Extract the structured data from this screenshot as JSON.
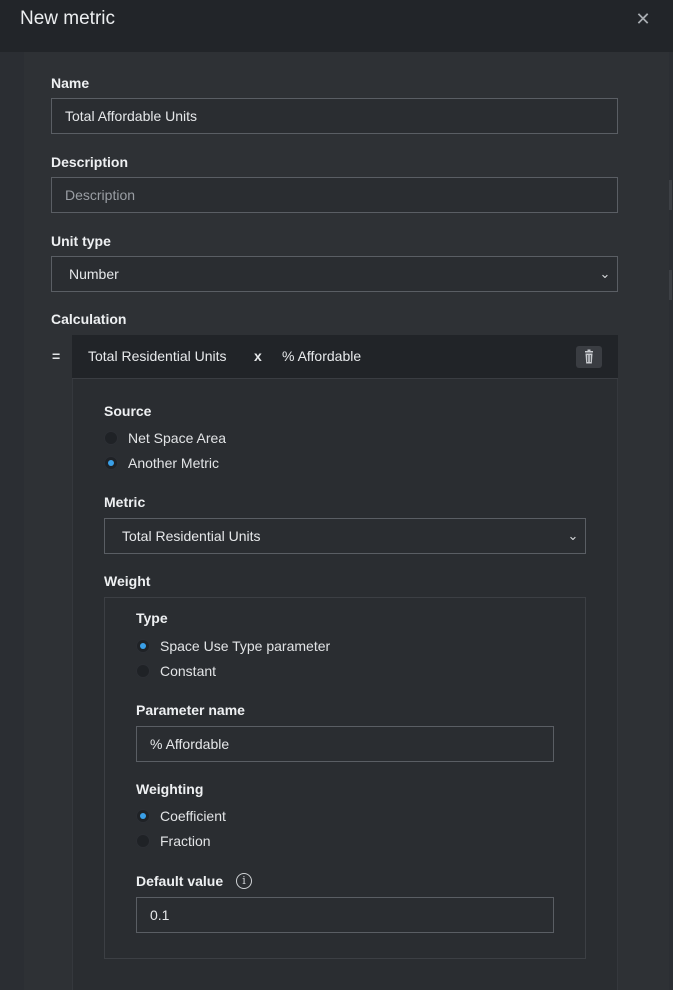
{
  "dialog": {
    "title": "New metric",
    "close_icon": "close-icon"
  },
  "name": {
    "label": "Name",
    "value": "Total Affordable Units"
  },
  "description": {
    "label": "Description",
    "placeholder": "Description",
    "value": ""
  },
  "unit_type": {
    "label": "Unit type",
    "selected": "Number"
  },
  "calculation": {
    "label": "Calculation",
    "equals": "=",
    "term1": "Total Residential Units",
    "operator": "x",
    "term2": "% Affordable",
    "delete_icon": "trash-icon"
  },
  "source": {
    "label": "Source",
    "options": [
      {
        "label": "Net Space Area",
        "selected": false
      },
      {
        "label": "Another Metric",
        "selected": true
      }
    ]
  },
  "metric": {
    "label": "Metric",
    "selected": "Total Residential Units"
  },
  "weight": {
    "label": "Weight",
    "type": {
      "label": "Type",
      "options": [
        {
          "label": "Space Use Type parameter",
          "selected": true
        },
        {
          "label": "Constant",
          "selected": false
        }
      ]
    },
    "parameter_name": {
      "label": "Parameter name",
      "value": "% Affordable"
    },
    "weighting": {
      "label": "Weighting",
      "options": [
        {
          "label": "Coefficient",
          "selected": true
        },
        {
          "label": "Fraction",
          "selected": false
        }
      ]
    },
    "default_value": {
      "label": "Default value",
      "value": "0.1",
      "info_icon": "info-icon"
    }
  },
  "colors": {
    "accent": "#3aa0e8",
    "background": "#2b2e33",
    "header": "#222529"
  }
}
